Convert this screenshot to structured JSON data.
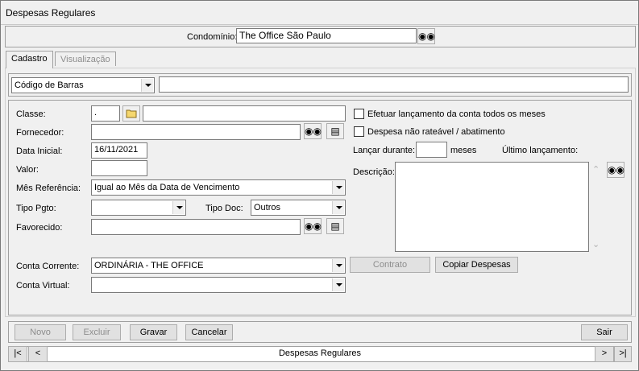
{
  "window": {
    "title": "Despesas Regulares"
  },
  "header": {
    "condominio_label": "Condomínio:",
    "condominio_value": "The Office São Paulo"
  },
  "tabs": [
    {
      "label": "Cadastro"
    },
    {
      "label": "Visualização"
    }
  ],
  "barcode": {
    "type_value": "Código de Barras",
    "value": ""
  },
  "form": {
    "classe_label": "Classe:",
    "classe_code": ".",
    "classe_desc": "",
    "fornecedor_label": "Fornecedor:",
    "fornecedor_value": "",
    "data_inicial_label": "Data Inicial:",
    "data_inicial_value": "16/11/2021",
    "valor_label": "Valor:",
    "valor_value": "",
    "mes_referencia_label": "Mês Referência:",
    "mes_referencia_value": "Igual ao Mês da Data de Vencimento",
    "tipo_pgto_label": "Tipo Pgto:",
    "tipo_pgto_value": "",
    "tipo_doc_label": "Tipo Doc:",
    "tipo_doc_value": "Outros",
    "favorecido_label": "Favorecido:",
    "favorecido_value": "",
    "conta_corrente_label": "Conta Corrente:",
    "conta_corrente_value": "ORDINÁRIA - THE OFFICE",
    "conta_virtual_label": "Conta Virtual:",
    "conta_virtual_value": ""
  },
  "right": {
    "efetuar_label": "Efetuar lançamento da conta todos os meses",
    "despesa_label": "Despesa não rateável / abatimento",
    "lancar_label": "Lançar durante:",
    "lancar_value": "",
    "meses_label": "meses",
    "ultimo_label": "Último lançamento:",
    "descricao_label": "Descrição:",
    "descricao_value": ""
  },
  "buttons": {
    "contrato": "Contrato",
    "copiar": "Copiar Despesas",
    "novo": "Novo",
    "excluir": "Excluir",
    "gravar": "Gravar",
    "cancelar": "Cancelar",
    "sair": "Sair"
  },
  "navigator": {
    "first": "|<",
    "prev": "<",
    "label": "Despesas Regulares",
    "next": ">",
    "last": ">|"
  }
}
